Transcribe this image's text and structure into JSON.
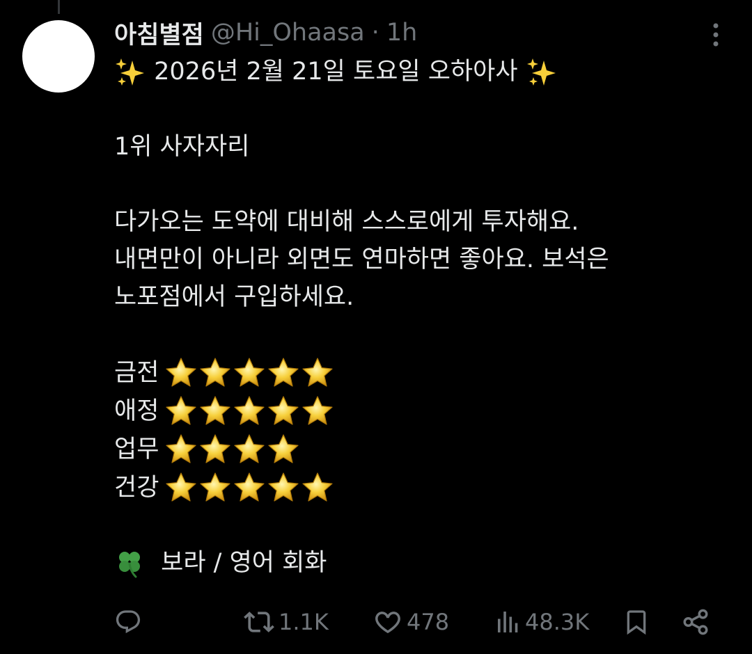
{
  "tweet": {
    "display_name": "아침별점",
    "handle": "@Hi_Ohaasa",
    "separator": "·",
    "time": "1h",
    "title_text": "2026년 2월 21일 토요일 오하아사",
    "rank_line": "1위 사자자리",
    "message_lines": [
      "다가오는 도약에 대비해 스스로에게 투자해요.",
      "내면만이 아니라 외면도 연마하면 좋아요. 보석은",
      "노포점에서 구입하세요."
    ],
    "ratings": [
      {
        "label": "금전",
        "stars": 5
      },
      {
        "label": "애정",
        "stars": 5
      },
      {
        "label": "업무",
        "stars": 4
      },
      {
        "label": "건강",
        "stars": 5
      }
    ],
    "lucky_line": "보라 / 영어 회화"
  },
  "actions": {
    "reply_icon": "reply-icon",
    "retweet_count": "1.1K",
    "like_count": "478",
    "view_count": "48.3K",
    "bookmark_icon": "bookmark-icon",
    "share_icon": "share-icon"
  },
  "colors": {
    "background": "#000000",
    "text_primary": "#e7e9ea",
    "text_secondary": "#71767b",
    "avatar": "#ffffff",
    "star": "#f5c518"
  },
  "icons": {
    "sparkle": "sparkles-icon",
    "star": "star-icon",
    "clover": "four-leaf-clover-icon",
    "more": "more-options-icon"
  }
}
